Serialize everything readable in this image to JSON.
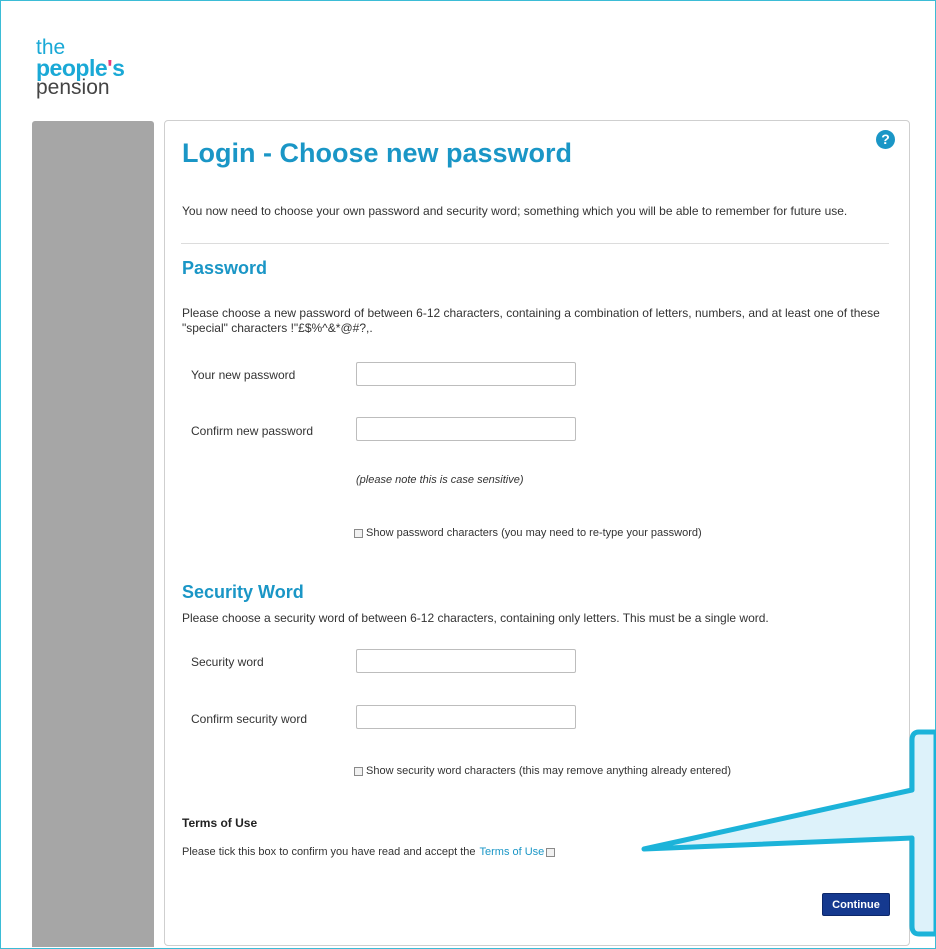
{
  "brand": {
    "logo_line1": "the",
    "logo_line2_a": "people",
    "logo_line2_apos": "'",
    "logo_line2_b": "s",
    "logo_line3": "pension",
    "accent_color": "#1a96c6",
    "apostrophe_color": "#e63a7c"
  },
  "help_icon": "question-icon",
  "page": {
    "title": "Login - Choose new password",
    "intro": "You now need to choose your own password and security word; something which you will be able to remember for future use."
  },
  "password": {
    "heading": "Password",
    "description": "Please choose a new password of between 6-12 characters, containing a combination of letters, numbers, and at least one of these \"special\" characters !\"£$%^&*@#?,.",
    "new_label": "Your new password",
    "new_value": "",
    "confirm_label": "Confirm new password",
    "confirm_value": "",
    "case_note": "(please note this is case sensitive)",
    "show_chars_label": "Show password characters (you may need to re-type your password)",
    "show_chars_checked": false
  },
  "security_word": {
    "heading": "Security Word",
    "description": "Please choose a security word of between 6-12 characters, containing only letters. This must be a single word.",
    "word_label": "Security word",
    "word_value": "",
    "confirm_label": "Confirm security word",
    "confirm_value": "",
    "show_chars_label": "Show security word characters (this may remove anything already entered)",
    "show_chars_checked": false
  },
  "terms": {
    "heading": "Terms of Use",
    "text": "Please tick this box to confirm you have read and accept the",
    "link_text": "Terms of Use",
    "checked": false
  },
  "continue_button": {
    "label": "Continue",
    "color": "#15398f"
  },
  "callout": {
    "fill": "#ddf2fa",
    "stroke": "#1cb3d9"
  }
}
